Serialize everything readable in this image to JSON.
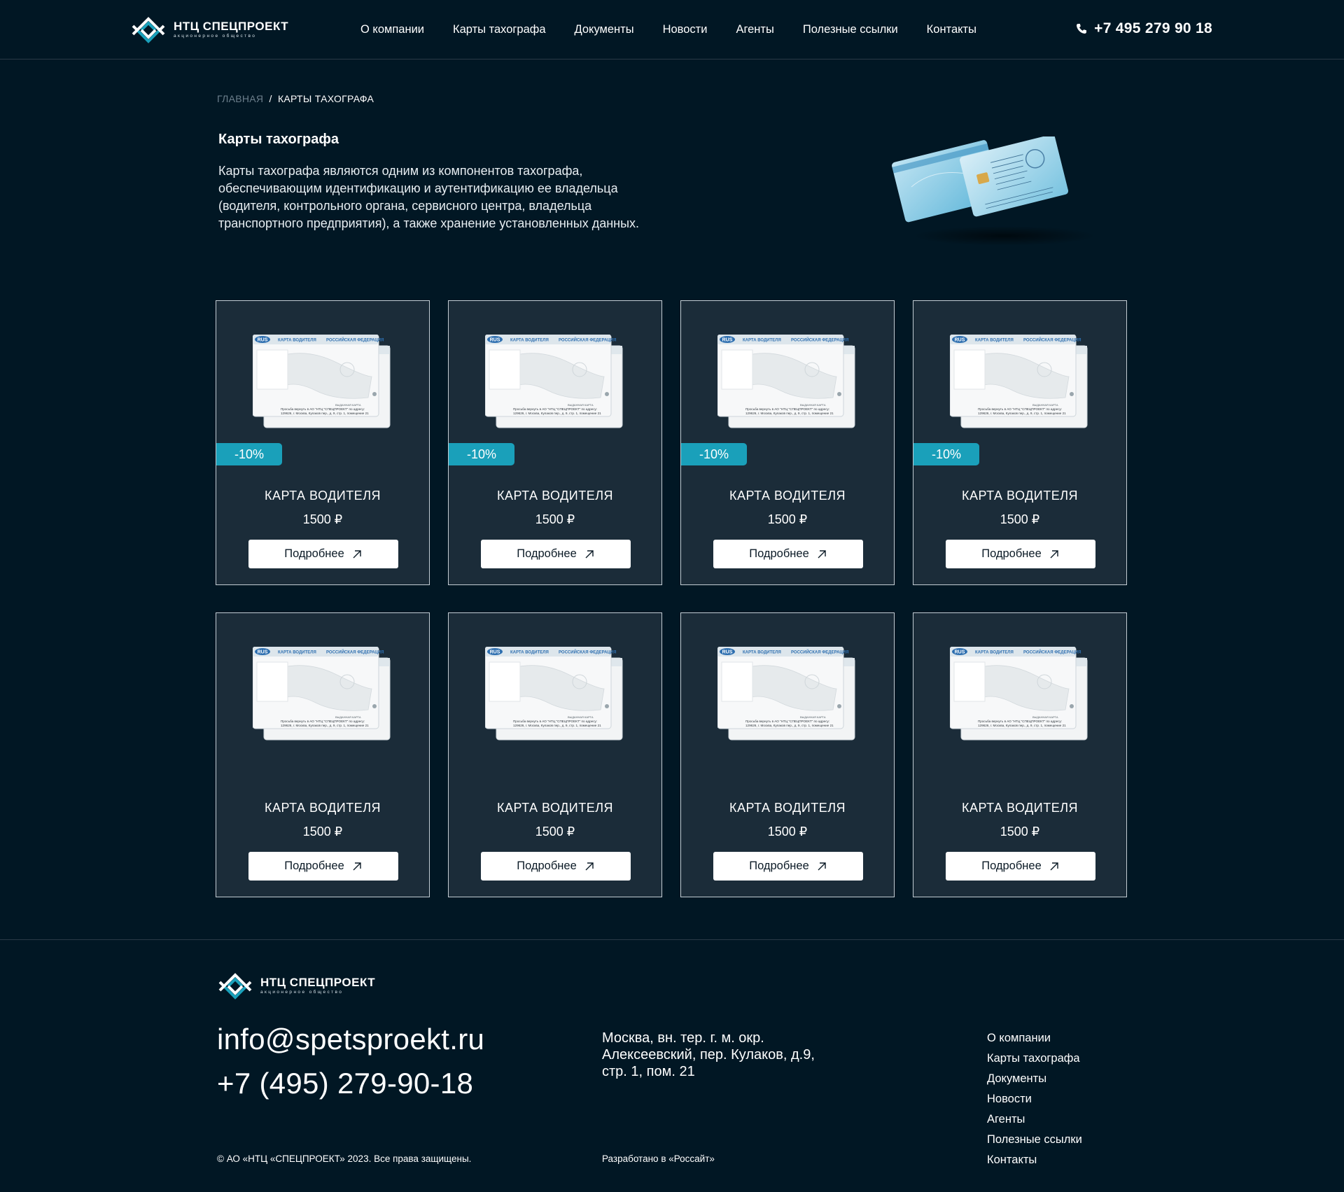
{
  "header": {
    "logo": {
      "name": "НТЦ СПЕЦПРОЕКТ",
      "subtitle": "акционерное общество"
    },
    "nav": [
      "О компании",
      "Карты тахографа",
      "Документы",
      "Новости",
      "Агенты",
      "Полезные ссылки",
      "Контакты"
    ],
    "phone": "+7 495 279 90 18"
  },
  "breadcrumb": {
    "home": "ГЛАВНАЯ",
    "separator": "/",
    "current": "КАРТЫ ТАХОГРАФА"
  },
  "intro": {
    "title": "Карты тахографа",
    "text": "Карты тахографа являются одним из компонентов тахографа, обеспечивающим идентификацию и аутентификацию ее владельца (водителя, контрольного органа, сервисного центра, владельца транспортного предприятия), а также хранение установленных данных."
  },
  "products": [
    {
      "title": "КАРТА ВОДИТЕЛЯ",
      "price": "1500 ₽",
      "discount": "-10%",
      "button": "Подробнее"
    },
    {
      "title": "КАРТА ВОДИТЕЛЯ",
      "price": "1500 ₽",
      "discount": "-10%",
      "button": "Подробнее"
    },
    {
      "title": "КАРТА ВОДИТЕЛЯ",
      "price": "1500 ₽",
      "discount": "-10%",
      "button": "Подробнее"
    },
    {
      "title": "КАРТА ВОДИТЕЛЯ",
      "price": "1500 ₽",
      "discount": "-10%",
      "button": "Подробнее"
    },
    {
      "title": "КАРТА ВОДИТЕЛЯ",
      "price": "1500 ₽",
      "discount": null,
      "button": "Подробнее"
    },
    {
      "title": "КАРТА ВОДИТЕЛЯ",
      "price": "1500 ₽",
      "discount": null,
      "button": "Подробнее"
    },
    {
      "title": "КАРТА ВОДИТЕЛЯ",
      "price": "1500 ₽",
      "discount": null,
      "button": "Подробнее"
    },
    {
      "title": "КАРТА ВОДИТЕЛЯ",
      "price": "1500 ₽",
      "discount": null,
      "button": "Подробнее"
    }
  ],
  "card_image": {
    "badge": "RUS",
    "header_left": "КАРТА ВОДИТЕЛЯ",
    "header_right": "РОССИЙСКАЯ ФЕДЕРАЦИЯ",
    "footer_line1": "Просьба вернуть в АО \"НТЦ \"СПЕЦПРОЕКТ\" по адресу:",
    "footer_line2": "129626, г. Москва, Кулаков пер., д. 9, стр. 1, помещение 21"
  },
  "footer": {
    "logo": {
      "name": "НТЦ СПЕЦПРОЕКТ",
      "subtitle": "акционерное общество"
    },
    "email": "info@spetsproekt.ru",
    "phone": "+7 (495) 279-90-18",
    "address": "Москва, вн. тер. г. м. окр. Алексеевский, пер. Кулаков, д.9, стр. 1, пом. 21",
    "nav": [
      "О компании",
      "Карты тахографа",
      "Документы",
      "Новости",
      "Агенты",
      "Полезные ссылки",
      "Контакты"
    ],
    "copyright": "© АО «НТЦ «СПЕЦПРОЕКТ» 2023. Все права защищены.",
    "developer": "Разработано в «Россайт»"
  },
  "icons": {
    "phone": "phone-icon",
    "arrow": "arrow-up-right-icon",
    "logo": "logo-mark-icon"
  },
  "colors": {
    "background": "#011724",
    "card_bg": "#1b2c39",
    "accent": "#1aa0ba",
    "text": "#ffffff"
  }
}
